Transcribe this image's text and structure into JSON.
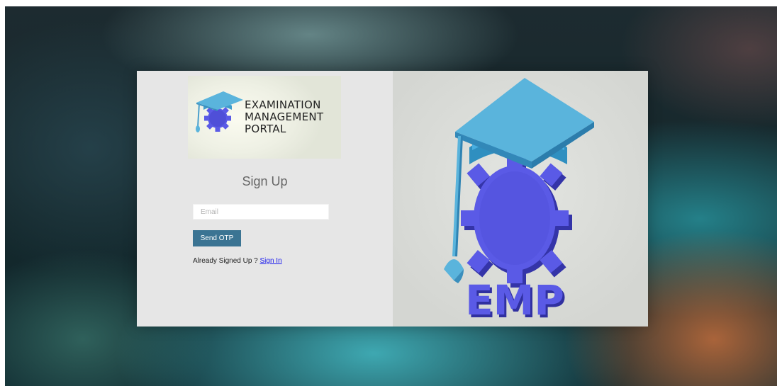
{
  "logo": {
    "line1": "EXAMINATION",
    "line2": "MANAGEMENT",
    "line3": "PORTAL"
  },
  "form": {
    "title": "Sign Up",
    "email_placeholder": "Email",
    "email_value": "",
    "send_otp_label": "Send OTP",
    "already_text": "Already Signed Up ? ",
    "signin_link_label": "Sign In"
  },
  "illustration": {
    "label": "EMP"
  },
  "colors": {
    "button": "#3b7493",
    "link": "#1a1aee",
    "cap": "#5ab4dc",
    "gear": "#5a5ae6"
  },
  "icons": {
    "logo": "graduation-cap-gear-icon",
    "hero": "graduation-cap-gear-icon"
  }
}
